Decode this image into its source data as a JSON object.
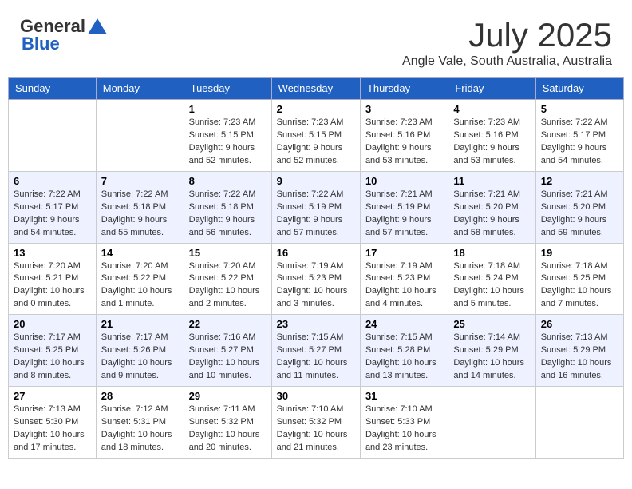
{
  "header": {
    "logo_general": "General",
    "logo_blue": "Blue",
    "month_year": "July 2025",
    "location": "Angle Vale, South Australia, Australia"
  },
  "days_of_week": [
    "Sunday",
    "Monday",
    "Tuesday",
    "Wednesday",
    "Thursday",
    "Friday",
    "Saturday"
  ],
  "weeks": [
    {
      "days": [
        {
          "num": "",
          "info": ""
        },
        {
          "num": "",
          "info": ""
        },
        {
          "num": "1",
          "info": "Sunrise: 7:23 AM\nSunset: 5:15 PM\nDaylight: 9 hours and 52 minutes."
        },
        {
          "num": "2",
          "info": "Sunrise: 7:23 AM\nSunset: 5:15 PM\nDaylight: 9 hours and 52 minutes."
        },
        {
          "num": "3",
          "info": "Sunrise: 7:23 AM\nSunset: 5:16 PM\nDaylight: 9 hours and 53 minutes."
        },
        {
          "num": "4",
          "info": "Sunrise: 7:23 AM\nSunset: 5:16 PM\nDaylight: 9 hours and 53 minutes."
        },
        {
          "num": "5",
          "info": "Sunrise: 7:22 AM\nSunset: 5:17 PM\nDaylight: 9 hours and 54 minutes."
        }
      ]
    },
    {
      "days": [
        {
          "num": "6",
          "info": "Sunrise: 7:22 AM\nSunset: 5:17 PM\nDaylight: 9 hours and 54 minutes."
        },
        {
          "num": "7",
          "info": "Sunrise: 7:22 AM\nSunset: 5:18 PM\nDaylight: 9 hours and 55 minutes."
        },
        {
          "num": "8",
          "info": "Sunrise: 7:22 AM\nSunset: 5:18 PM\nDaylight: 9 hours and 56 minutes."
        },
        {
          "num": "9",
          "info": "Sunrise: 7:22 AM\nSunset: 5:19 PM\nDaylight: 9 hours and 57 minutes."
        },
        {
          "num": "10",
          "info": "Sunrise: 7:21 AM\nSunset: 5:19 PM\nDaylight: 9 hours and 57 minutes."
        },
        {
          "num": "11",
          "info": "Sunrise: 7:21 AM\nSunset: 5:20 PM\nDaylight: 9 hours and 58 minutes."
        },
        {
          "num": "12",
          "info": "Sunrise: 7:21 AM\nSunset: 5:20 PM\nDaylight: 9 hours and 59 minutes."
        }
      ]
    },
    {
      "days": [
        {
          "num": "13",
          "info": "Sunrise: 7:20 AM\nSunset: 5:21 PM\nDaylight: 10 hours and 0 minutes."
        },
        {
          "num": "14",
          "info": "Sunrise: 7:20 AM\nSunset: 5:22 PM\nDaylight: 10 hours and 1 minute."
        },
        {
          "num": "15",
          "info": "Sunrise: 7:20 AM\nSunset: 5:22 PM\nDaylight: 10 hours and 2 minutes."
        },
        {
          "num": "16",
          "info": "Sunrise: 7:19 AM\nSunset: 5:23 PM\nDaylight: 10 hours and 3 minutes."
        },
        {
          "num": "17",
          "info": "Sunrise: 7:19 AM\nSunset: 5:23 PM\nDaylight: 10 hours and 4 minutes."
        },
        {
          "num": "18",
          "info": "Sunrise: 7:18 AM\nSunset: 5:24 PM\nDaylight: 10 hours and 5 minutes."
        },
        {
          "num": "19",
          "info": "Sunrise: 7:18 AM\nSunset: 5:25 PM\nDaylight: 10 hours and 7 minutes."
        }
      ]
    },
    {
      "days": [
        {
          "num": "20",
          "info": "Sunrise: 7:17 AM\nSunset: 5:25 PM\nDaylight: 10 hours and 8 minutes."
        },
        {
          "num": "21",
          "info": "Sunrise: 7:17 AM\nSunset: 5:26 PM\nDaylight: 10 hours and 9 minutes."
        },
        {
          "num": "22",
          "info": "Sunrise: 7:16 AM\nSunset: 5:27 PM\nDaylight: 10 hours and 10 minutes."
        },
        {
          "num": "23",
          "info": "Sunrise: 7:15 AM\nSunset: 5:27 PM\nDaylight: 10 hours and 11 minutes."
        },
        {
          "num": "24",
          "info": "Sunrise: 7:15 AM\nSunset: 5:28 PM\nDaylight: 10 hours and 13 minutes."
        },
        {
          "num": "25",
          "info": "Sunrise: 7:14 AM\nSunset: 5:29 PM\nDaylight: 10 hours and 14 minutes."
        },
        {
          "num": "26",
          "info": "Sunrise: 7:13 AM\nSunset: 5:29 PM\nDaylight: 10 hours and 16 minutes."
        }
      ]
    },
    {
      "days": [
        {
          "num": "27",
          "info": "Sunrise: 7:13 AM\nSunset: 5:30 PM\nDaylight: 10 hours and 17 minutes."
        },
        {
          "num": "28",
          "info": "Sunrise: 7:12 AM\nSunset: 5:31 PM\nDaylight: 10 hours and 18 minutes."
        },
        {
          "num": "29",
          "info": "Sunrise: 7:11 AM\nSunset: 5:32 PM\nDaylight: 10 hours and 20 minutes."
        },
        {
          "num": "30",
          "info": "Sunrise: 7:10 AM\nSunset: 5:32 PM\nDaylight: 10 hours and 21 minutes."
        },
        {
          "num": "31",
          "info": "Sunrise: 7:10 AM\nSunset: 5:33 PM\nDaylight: 10 hours and 23 minutes."
        },
        {
          "num": "",
          "info": ""
        },
        {
          "num": "",
          "info": ""
        }
      ]
    }
  ]
}
